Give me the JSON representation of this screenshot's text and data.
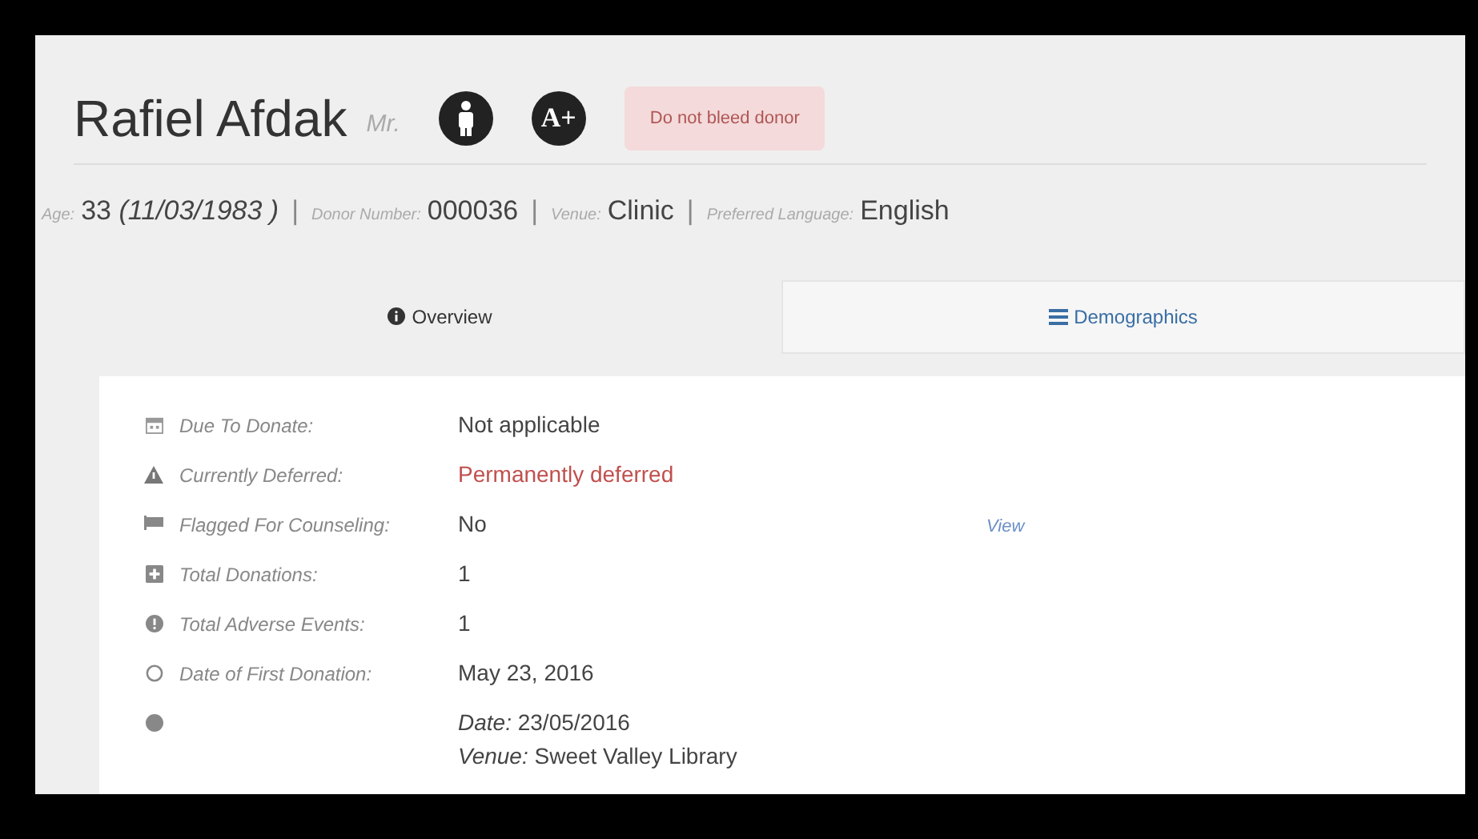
{
  "donor": {
    "name": "Rafiel Afdak",
    "title": "Mr.",
    "blood_group": "A+",
    "alert": "Do not bleed donor"
  },
  "info": [
    {
      "label": "Age:",
      "value": "33 *(11/03/1983 )*"
    },
    {
      "label": "Donor Number:",
      "value": "000036"
    },
    {
      "label": "Venue:",
      "value": "Clinic"
    },
    {
      "label": "Preferred Language:",
      "value": "English"
    }
  ],
  "separator": "|",
  "tabs": [
    {
      "label": "Overview",
      "selected": true,
      "kind": "info"
    },
    {
      "label": "Demographics",
      "selected": false,
      "kind": "list"
    }
  ],
  "details": [
    {
      "kind": "calendar",
      "label": "Due To Donate:",
      "lines": [
        "Not applicable"
      ]
    },
    {
      "kind": "warning",
      "label": "Currently Deferred:",
      "lines": [
        "Permanently deferred"
      ],
      "alert": true
    },
    {
      "kind": "flag",
      "label": "Flagged For Counseling:",
      "lines": [
        "No"
      ],
      "link": "View"
    },
    {
      "kind": "plus",
      "label": "Total Donations:",
      "lines": [
        "1"
      ]
    },
    {
      "kind": "exclamation",
      "label": "Total Adverse Events:",
      "lines": [
        "1"
      ]
    },
    {
      "kind": "circle",
      "label": "Date of First Donation:",
      "lines": [
        "May 23, 2016"
      ]
    },
    {
      "kind": "dot",
      "lines": [
        "*Date:* 23/05/2016",
        "*Venue:* Sweet Valley Library"
      ]
    }
  ]
}
